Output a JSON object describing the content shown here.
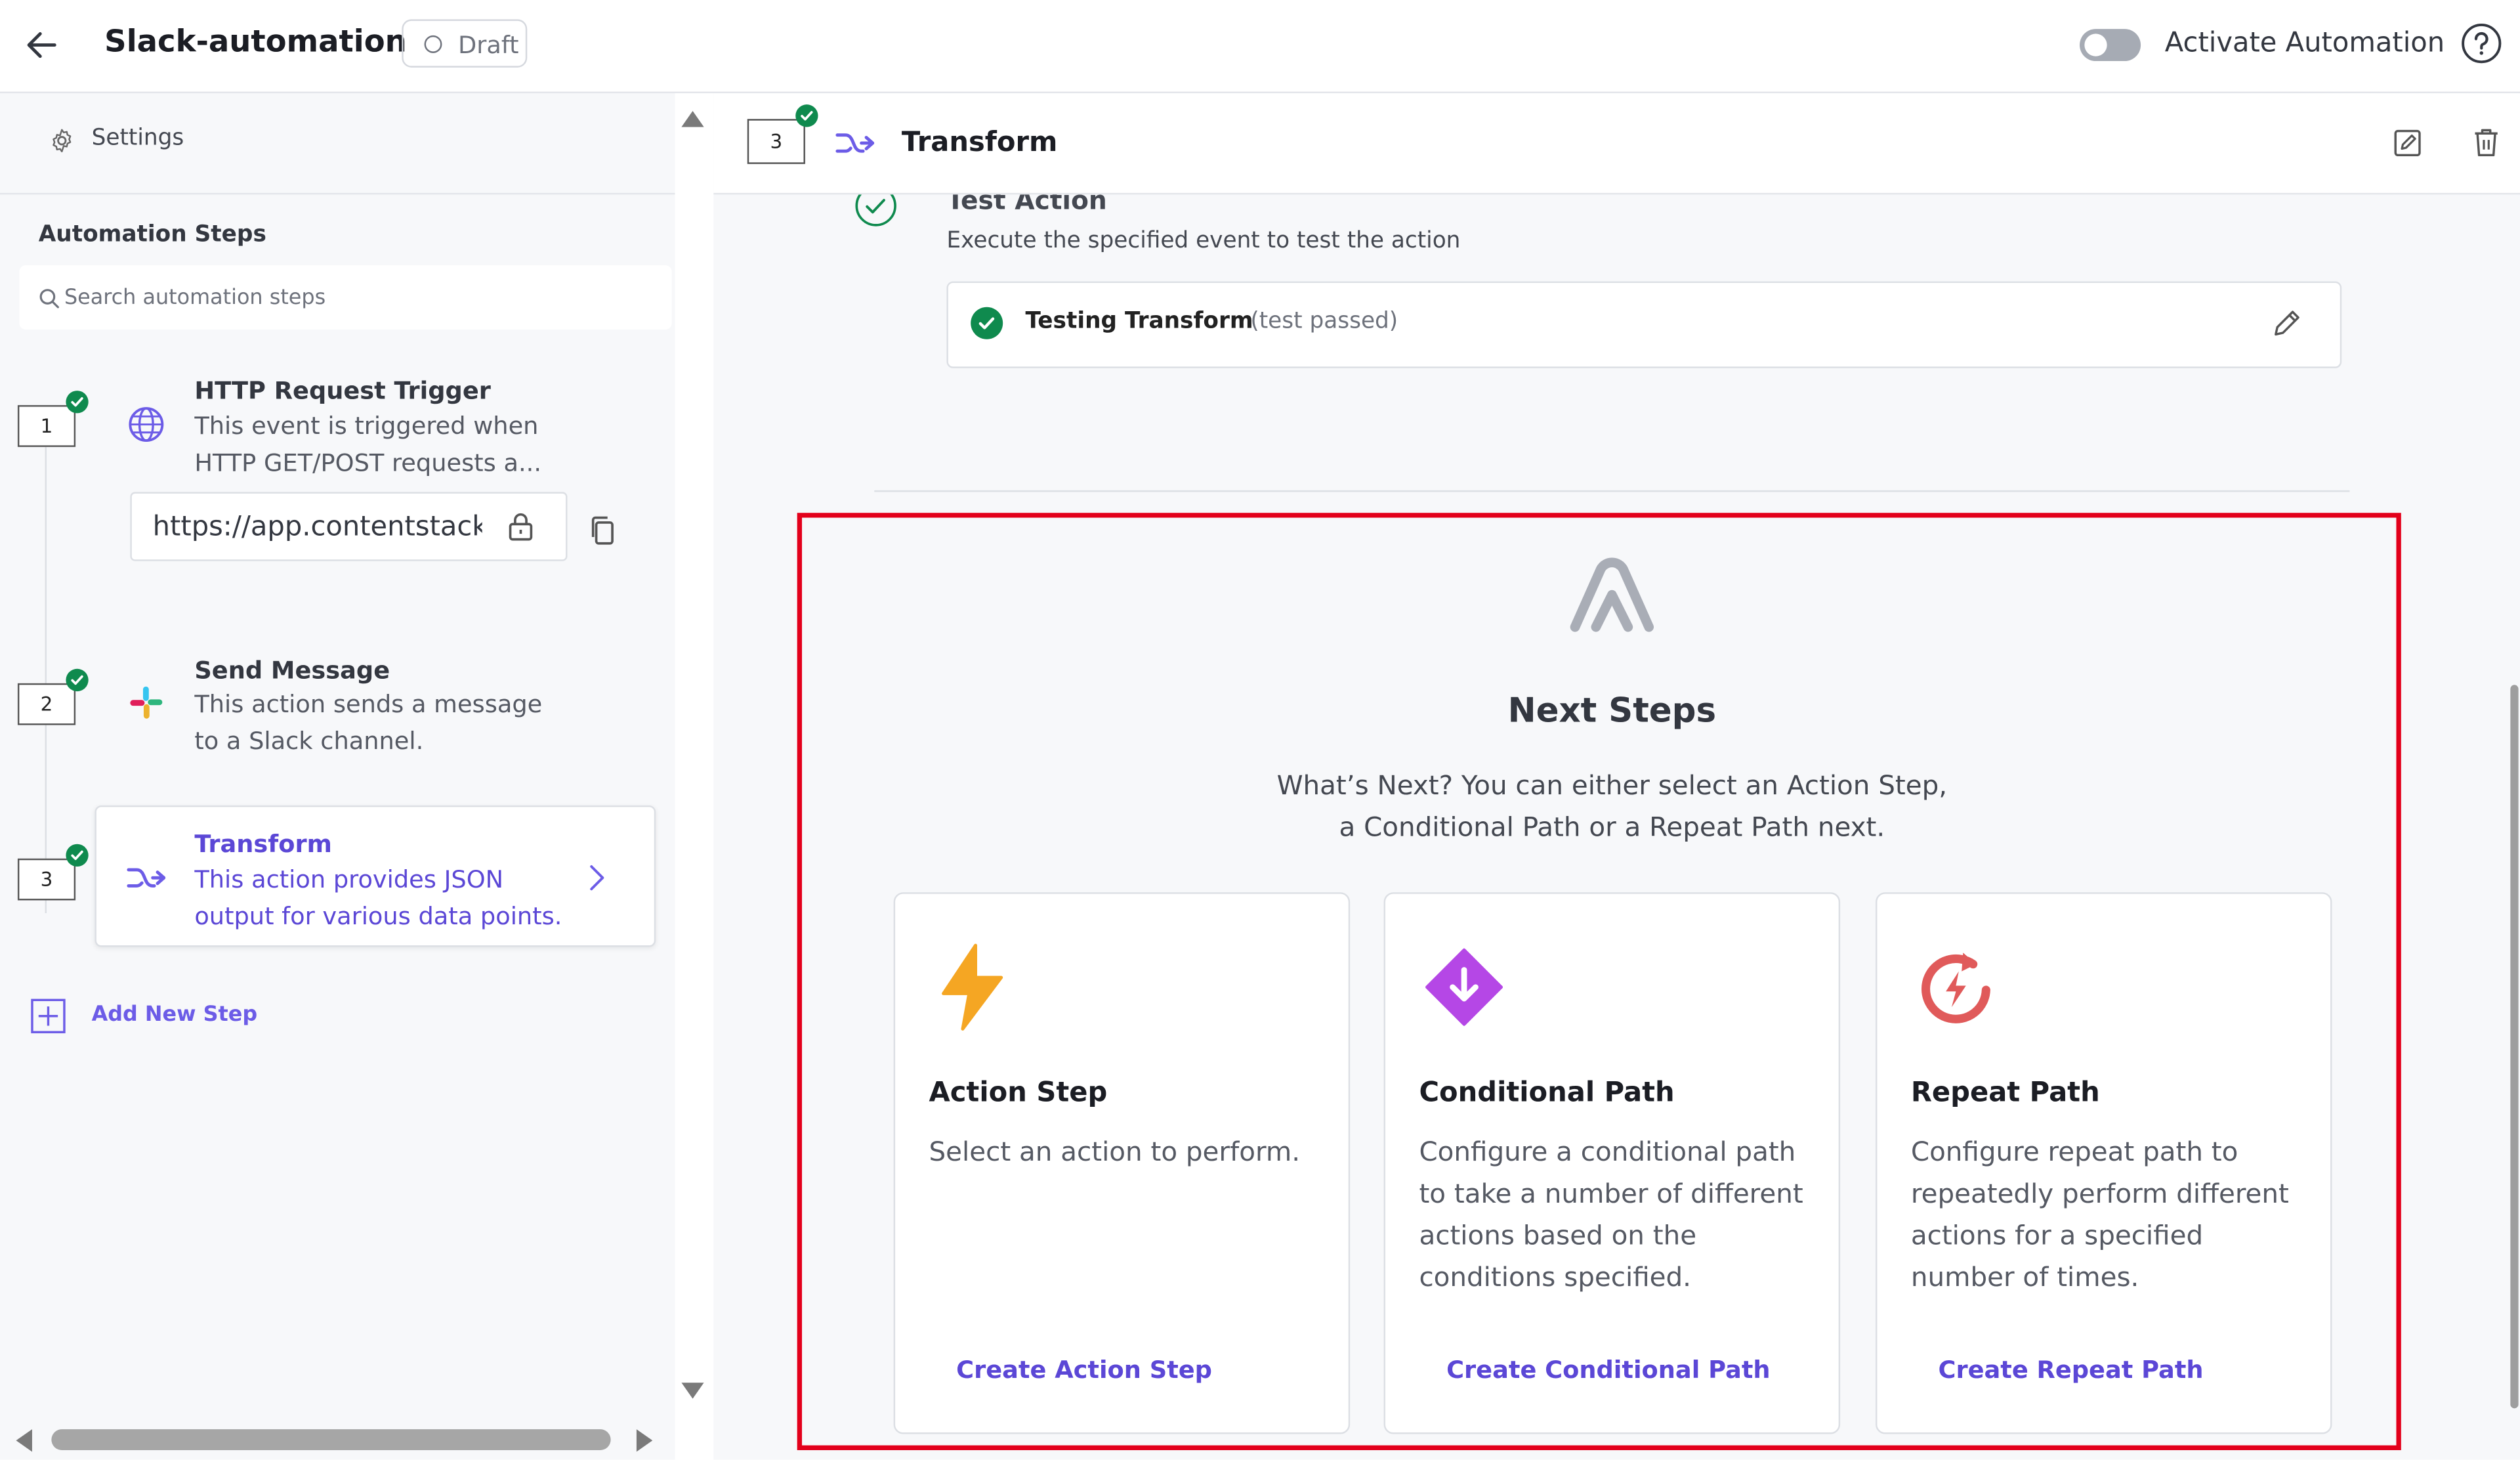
{
  "header": {
    "title": "Slack-automation",
    "status_badge": "Draft",
    "activate_label": "Activate Automation"
  },
  "sidebar": {
    "settings_label": "Settings",
    "steps_heading": "Automation Steps",
    "search_placeholder": "Search automation steps",
    "steps": [
      {
        "number": "1",
        "title": "HTTP Request Trigger",
        "desc_line1": "This event is triggered when",
        "desc_line2": "HTTP GET/POST requests a...",
        "url": "https://app.contentstack.com/automations-api/run/..."
      },
      {
        "number": "2",
        "title": "Send Message",
        "desc_line1": "This action sends a message",
        "desc_line2": "to a Slack channel."
      },
      {
        "number": "3",
        "title": "Transform",
        "desc_line1": "This action provides JSON",
        "desc_line2": "output for various data points."
      }
    ],
    "add_step_label": "Add New Step"
  },
  "main": {
    "step_number": "3",
    "title": "Transform",
    "test": {
      "heading": "Test Action",
      "description": "Execute the specified event to test the action",
      "result_title": "Testing Transform",
      "result_status": "(test passed)"
    },
    "next_steps": {
      "title": "Next Steps",
      "desc_line1": "What’s Next? You can either select an Action Step,",
      "desc_line2": "a Conditional Path or a Repeat Path next.",
      "cards": [
        {
          "icon": "lightning-icon",
          "title": "Action Step",
          "description": "Select an action to perform.",
          "link": "Create Action Step"
        },
        {
          "icon": "conditional-diamond-icon",
          "title": "Conditional Path",
          "description": "Configure a conditional path to take a number of different actions based on the conditions specified.",
          "link": "Create Conditional Path"
        },
        {
          "icon": "repeat-icon",
          "title": "Repeat Path",
          "description": "Configure repeat path to repeatedly perform different actions for a specified number of times.",
          "link": "Create Repeat Path"
        }
      ]
    }
  },
  "colors": {
    "accent": "#6c5ce7",
    "link": "#5b47d6",
    "success": "#0f8a4e",
    "highlight": "#e3001b",
    "lightning": "#f5a623",
    "conditional": "#b547e6",
    "repeat": "#e05a5a"
  }
}
